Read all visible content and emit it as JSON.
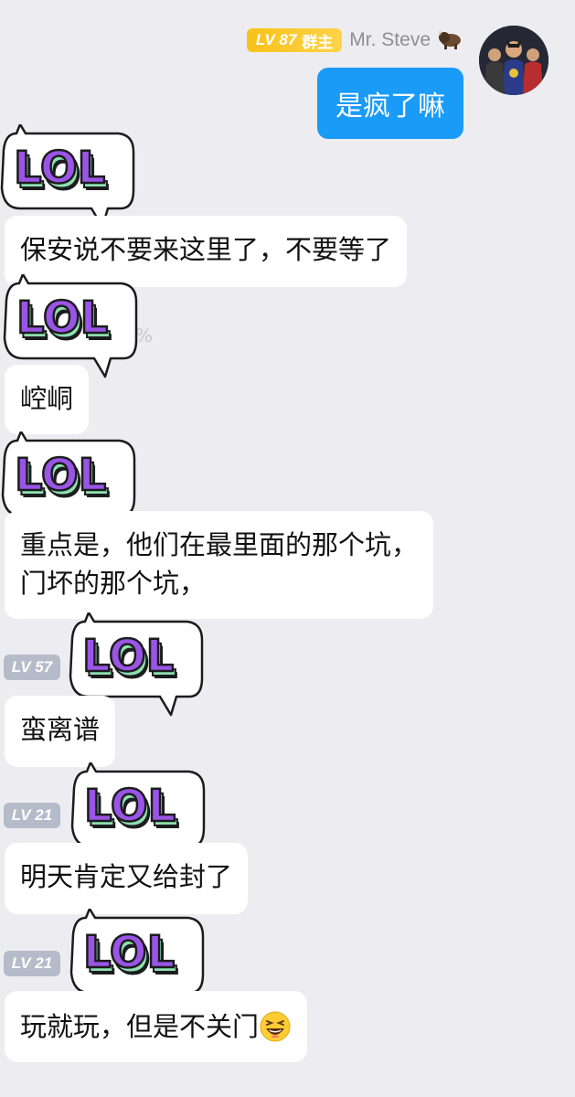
{
  "own": {
    "badge_level": "LV 87",
    "badge_role": "群主",
    "name": "Mr. Steve",
    "name_emoji": "bison-icon",
    "message": "是疯了嘛"
  },
  "sticker": {
    "text": "LOL",
    "icon": "lol-speech-bubble-sticker"
  },
  "messages": [
    {
      "badge": "",
      "text": "保安说不要来这里了，不要等了"
    },
    {
      "badge": "",
      "text": "崆峒"
    },
    {
      "badge": "",
      "text": "重点是，他们在最里面的那个坑，",
      "text2": "门坏的那个坑，"
    },
    {
      "badge": "LV 57",
      "text": "蛮离谱"
    },
    {
      "badge": "LV 21",
      "text": "明天肯定又给封了"
    },
    {
      "badge": "LV 21",
      "text": "玩就玩，但是不关门",
      "emoji": "grinning-squinting-face-icon"
    }
  ],
  "partial_text": "%",
  "colors": {
    "background": "#ededf1",
    "own_bubble": "#1a9bf8",
    "owner_badge": "#f8c21a",
    "level_badge": "#b6bbca",
    "sticker_purple": "#9a55e6",
    "sticker_green": "#8ee0b1"
  }
}
